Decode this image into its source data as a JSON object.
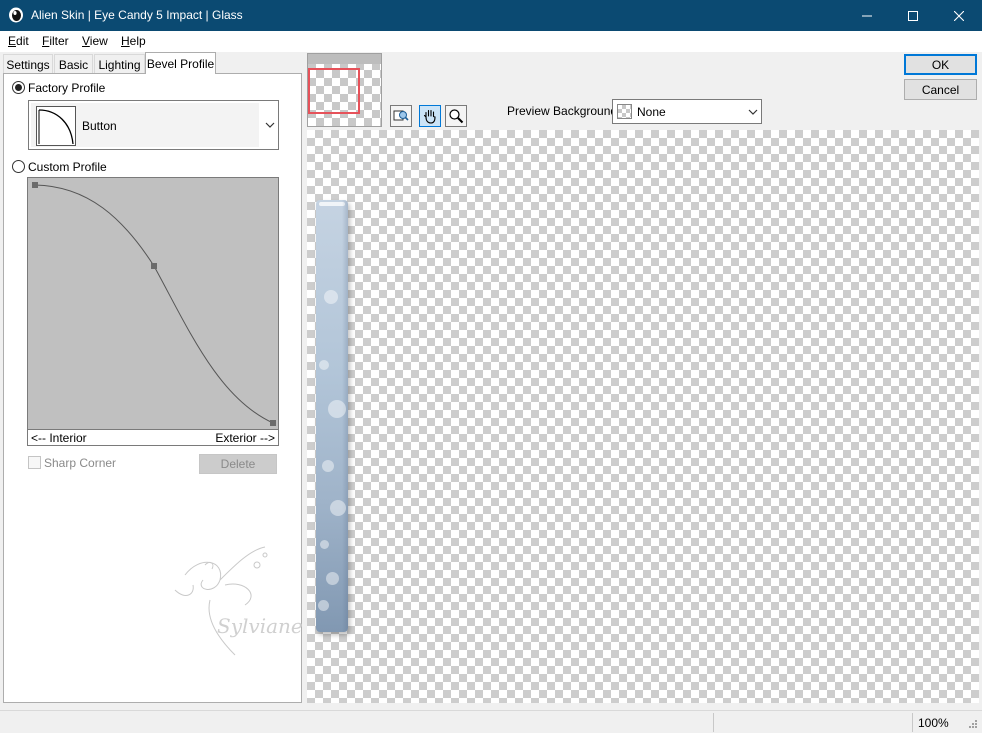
{
  "window": {
    "title": "Alien Skin | Eye Candy 5 Impact | Glass",
    "titlebar_color": "#0b4a72"
  },
  "menu": {
    "items": [
      {
        "label": "Edit",
        "underline": "E",
        "rest": "dit"
      },
      {
        "label": "Filter",
        "underline": "F",
        "rest": "ilter"
      },
      {
        "label": "View",
        "underline": "V",
        "rest": "iew"
      },
      {
        "label": "Help",
        "underline": "H",
        "rest": "elp"
      }
    ]
  },
  "tabs": [
    {
      "label": "Settings"
    },
    {
      "label": "Basic"
    },
    {
      "label": "Lighting"
    },
    {
      "label": "Bevel Profile",
      "active": true
    }
  ],
  "bevel": {
    "factory_profile_label": "Factory Profile",
    "factory_selected": true,
    "profile_name": "Button",
    "custom_profile_label": "Custom Profile",
    "interior_label": "<-- Interior",
    "exterior_label": "Exterior -->",
    "sharp_corner_label": "Sharp Corner",
    "sharp_corner_checked": false,
    "delete_label": "Delete"
  },
  "preview": {
    "background_label": "Preview Background:",
    "background_value": "None",
    "tools": [
      "zoom-preview-icon",
      "hand-icon",
      "magnifier-icon"
    ],
    "active_tool": "hand-icon"
  },
  "actions": {
    "ok_label": "OK",
    "cancel_label": "Cancel"
  },
  "status": {
    "zoom": "100%"
  },
  "watermark": {
    "text": "Sylviane"
  },
  "colors": {
    "accent": "#0078d7",
    "nav_frame": "#e6525a",
    "curve_bg": "#c0c0c0"
  }
}
